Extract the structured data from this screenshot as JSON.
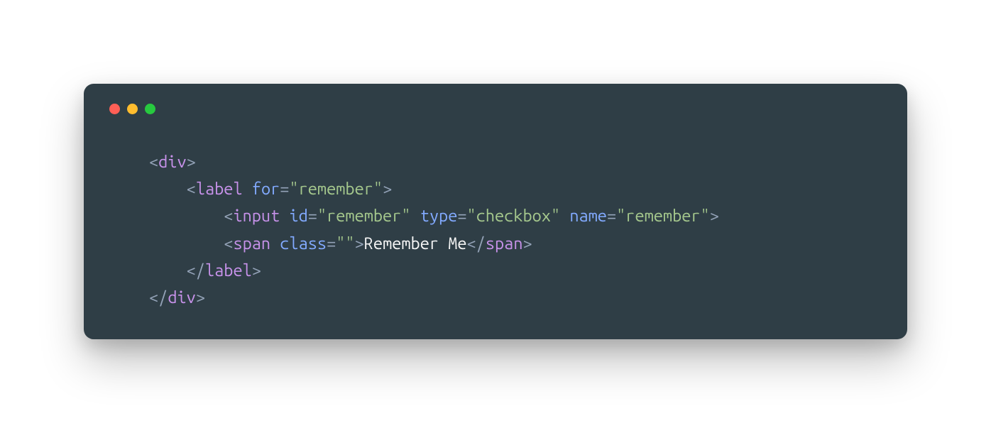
{
  "code": {
    "l1": {
      "b1": "<",
      "tag": "div",
      "b2": ">"
    },
    "l2": {
      "indent": "    ",
      "b1": "<",
      "tag": "label",
      "sp": " ",
      "attr": "for",
      "eq": "=",
      "val": "\"remember\"",
      "b2": ">"
    },
    "l3": {
      "indent": "        ",
      "b1": "<",
      "tag": "input",
      "sp1": " ",
      "a1": "id",
      "eq1": "=",
      "v1": "\"remember\"",
      "sp2": " ",
      "a2": "type",
      "eq2": "=",
      "v2": "\"checkbox\"",
      "sp3": " ",
      "a3": "name",
      "eq3": "=",
      "v3": "\"remember\"",
      "b2": ">"
    },
    "l4": {
      "indent": "        ",
      "b1": "<",
      "tag": "span",
      "sp": " ",
      "attr": "class",
      "eq": "=",
      "val": "\"\"",
      "b2": ">",
      "text": "Remember Me",
      "b3": "</",
      "tag2": "span",
      "b4": ">"
    },
    "l5": {
      "indent": "    ",
      "b1": "</",
      "tag": "label",
      "b2": ">"
    },
    "l6": {
      "b1": "</",
      "tag": "div",
      "b2": ">"
    }
  }
}
